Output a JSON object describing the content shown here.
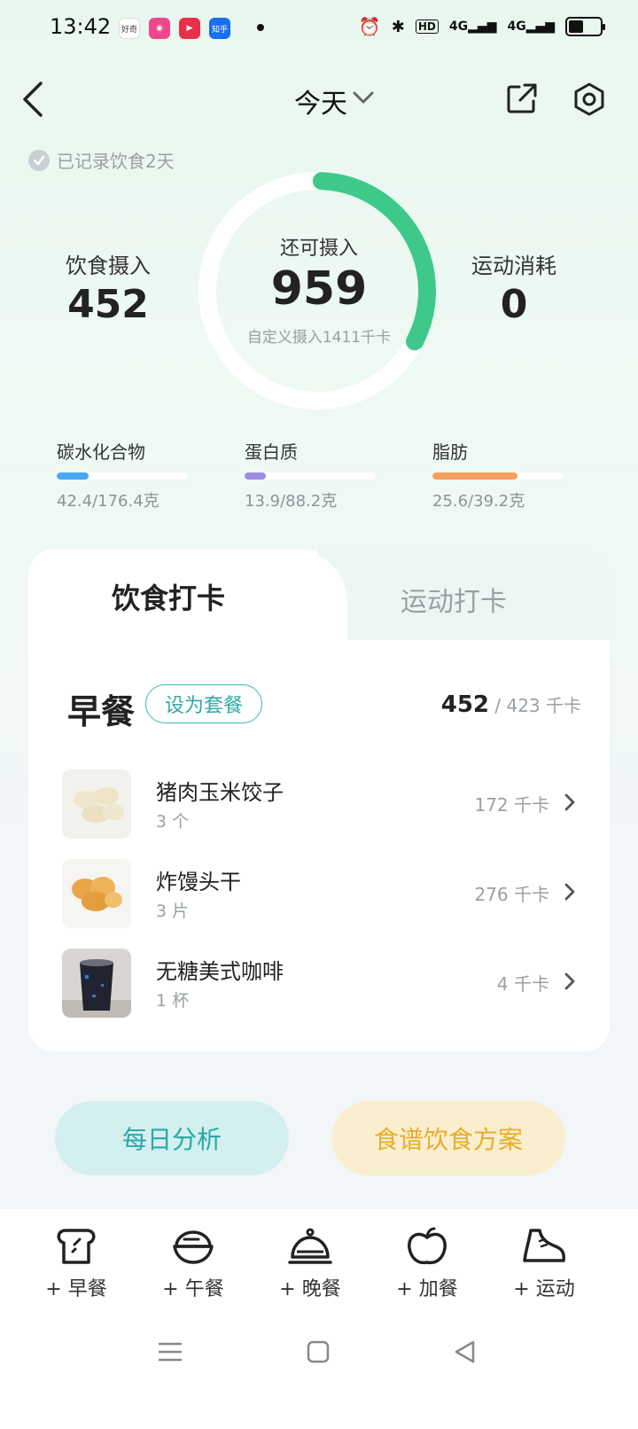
{
  "status_bar": {
    "time": "13:42",
    "apps": [
      {
        "name": "haoqi-icon",
        "label": "好奇",
        "color": "#ffffff",
        "text": "#444444"
      },
      {
        "name": "app-icon-2",
        "label": "",
        "color": "#f0478c"
      },
      {
        "name": "video-icon",
        "label": "",
        "color": "#e8304a"
      },
      {
        "name": "zhihu-icon",
        "label": "知乎",
        "color": "#1a6ef0"
      }
    ],
    "network": "4G",
    "hd_label": "HD"
  },
  "header": {
    "date_label": "今天",
    "recorded_text": "已记录饮食2天"
  },
  "summary": {
    "intake_label": "饮食摄入",
    "intake_value": "452",
    "remaining_label": "还可摄入",
    "remaining_value": "959",
    "target_text": "自定义摄入1411千卡",
    "burn_label": "运动消耗",
    "burn_value": "0",
    "ring_color": "#3ec98b",
    "ring_progress": 0.32
  },
  "macros": [
    {
      "name": "碳水化合物",
      "value": "42.4/176.4克",
      "fraction": 0.24,
      "color": "#4aa8ee"
    },
    {
      "name": "蛋白质",
      "value": "13.9/88.2克",
      "fraction": 0.16,
      "color": "#9b8fe0"
    },
    {
      "name": "脂肪",
      "value": "25.6/39.2克",
      "fraction": 0.65,
      "color": "#f5a15e"
    }
  ],
  "card": {
    "tab_active": "饮食打卡",
    "tab_inactive": "运动打卡",
    "meal_title": "早餐",
    "set_button": "设为套餐",
    "meal_kcal_current": "452",
    "meal_kcal_rest": " / 423 千卡",
    "foods": [
      {
        "name": "猪肉玉米饺子",
        "qty": "3 个",
        "kcal": "172 千卡"
      },
      {
        "name": "炸馒头干",
        "qty": "3 片",
        "kcal": "276 千卡"
      },
      {
        "name": "无糖美式咖啡",
        "qty": "1 杯",
        "kcal": "4 千卡"
      }
    ]
  },
  "buttons": {
    "daily_analysis": "每日分析",
    "recipe_plan": "食谱饮食方案"
  },
  "bottom_bar": [
    {
      "icon": "toast-icon",
      "label": "+ 早餐"
    },
    {
      "icon": "bowl-icon",
      "label": "+ 午餐"
    },
    {
      "icon": "cloche-icon",
      "label": "+ 晚餐"
    },
    {
      "icon": "apple-icon",
      "label": "+ 加餐"
    },
    {
      "icon": "shoe-icon",
      "label": "+ 运动"
    }
  ]
}
